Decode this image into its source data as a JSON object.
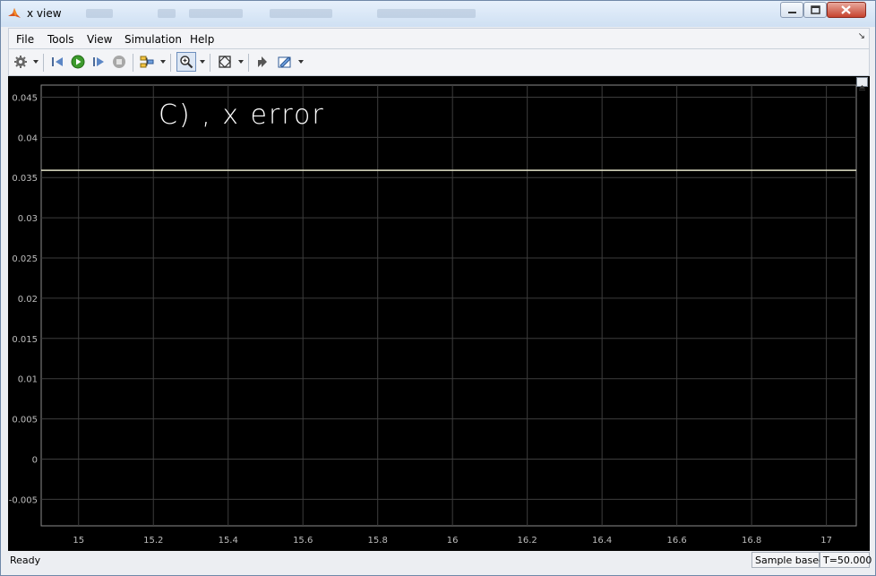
{
  "window": {
    "title": "x view",
    "minimize_icon": "minimize-icon",
    "maximize_icon": "maximize-icon",
    "close_icon": "close-icon"
  },
  "menu": {
    "items": [
      "File",
      "Tools",
      "View",
      "Simulation",
      "Help"
    ],
    "overflow_icon": "chevron-down-icon"
  },
  "toolbar": {
    "items": [
      "settings-gear-icon",
      "step-back-icon",
      "run-icon",
      "step-forward-icon",
      "stop-icon",
      "signal-selector-icon",
      "zoom-icon",
      "fit-to-view-icon",
      "highlight-block-icon",
      "style-icon"
    ]
  },
  "chart_data": {
    "type": "line",
    "title": "",
    "xlabel": "",
    "ylabel": "",
    "xlim": [
      14.9,
      17.08
    ],
    "ylim": [
      -0.0083,
      0.0465
    ],
    "x_ticks": [
      15,
      15.2,
      15.4,
      15.6,
      15.8,
      16,
      16.2,
      16.4,
      16.6,
      16.8,
      17
    ],
    "x_tick_labels": [
      "15",
      "15.2",
      "15.4",
      "15.6",
      "15.8",
      "16",
      "16.2",
      "16.4",
      "16.6",
      "16.8",
      "17"
    ],
    "y_ticks": [
      0.045,
      0.04,
      0.035,
      0.03,
      0.025,
      0.02,
      0.015,
      0.01,
      0.005,
      0,
      -0.005
    ],
    "y_tick_labels": [
      "0.045",
      "0.04",
      "0.035",
      "0.03",
      "0.025",
      "0.02",
      "0.015",
      "0.01",
      "0.005",
      "0",
      "-0.005"
    ],
    "grid": true,
    "background": "#000000",
    "grid_color": "#3d3d3d",
    "series": [
      {
        "color": "#e4e4c8",
        "x": [
          14.9,
          17.08
        ],
        "y": [
          0.0359,
          0.0359
        ]
      }
    ],
    "annotation": "C) , x error"
  },
  "status": {
    "ready": "Ready",
    "mode": "Sample based",
    "time": "T=50.000"
  }
}
